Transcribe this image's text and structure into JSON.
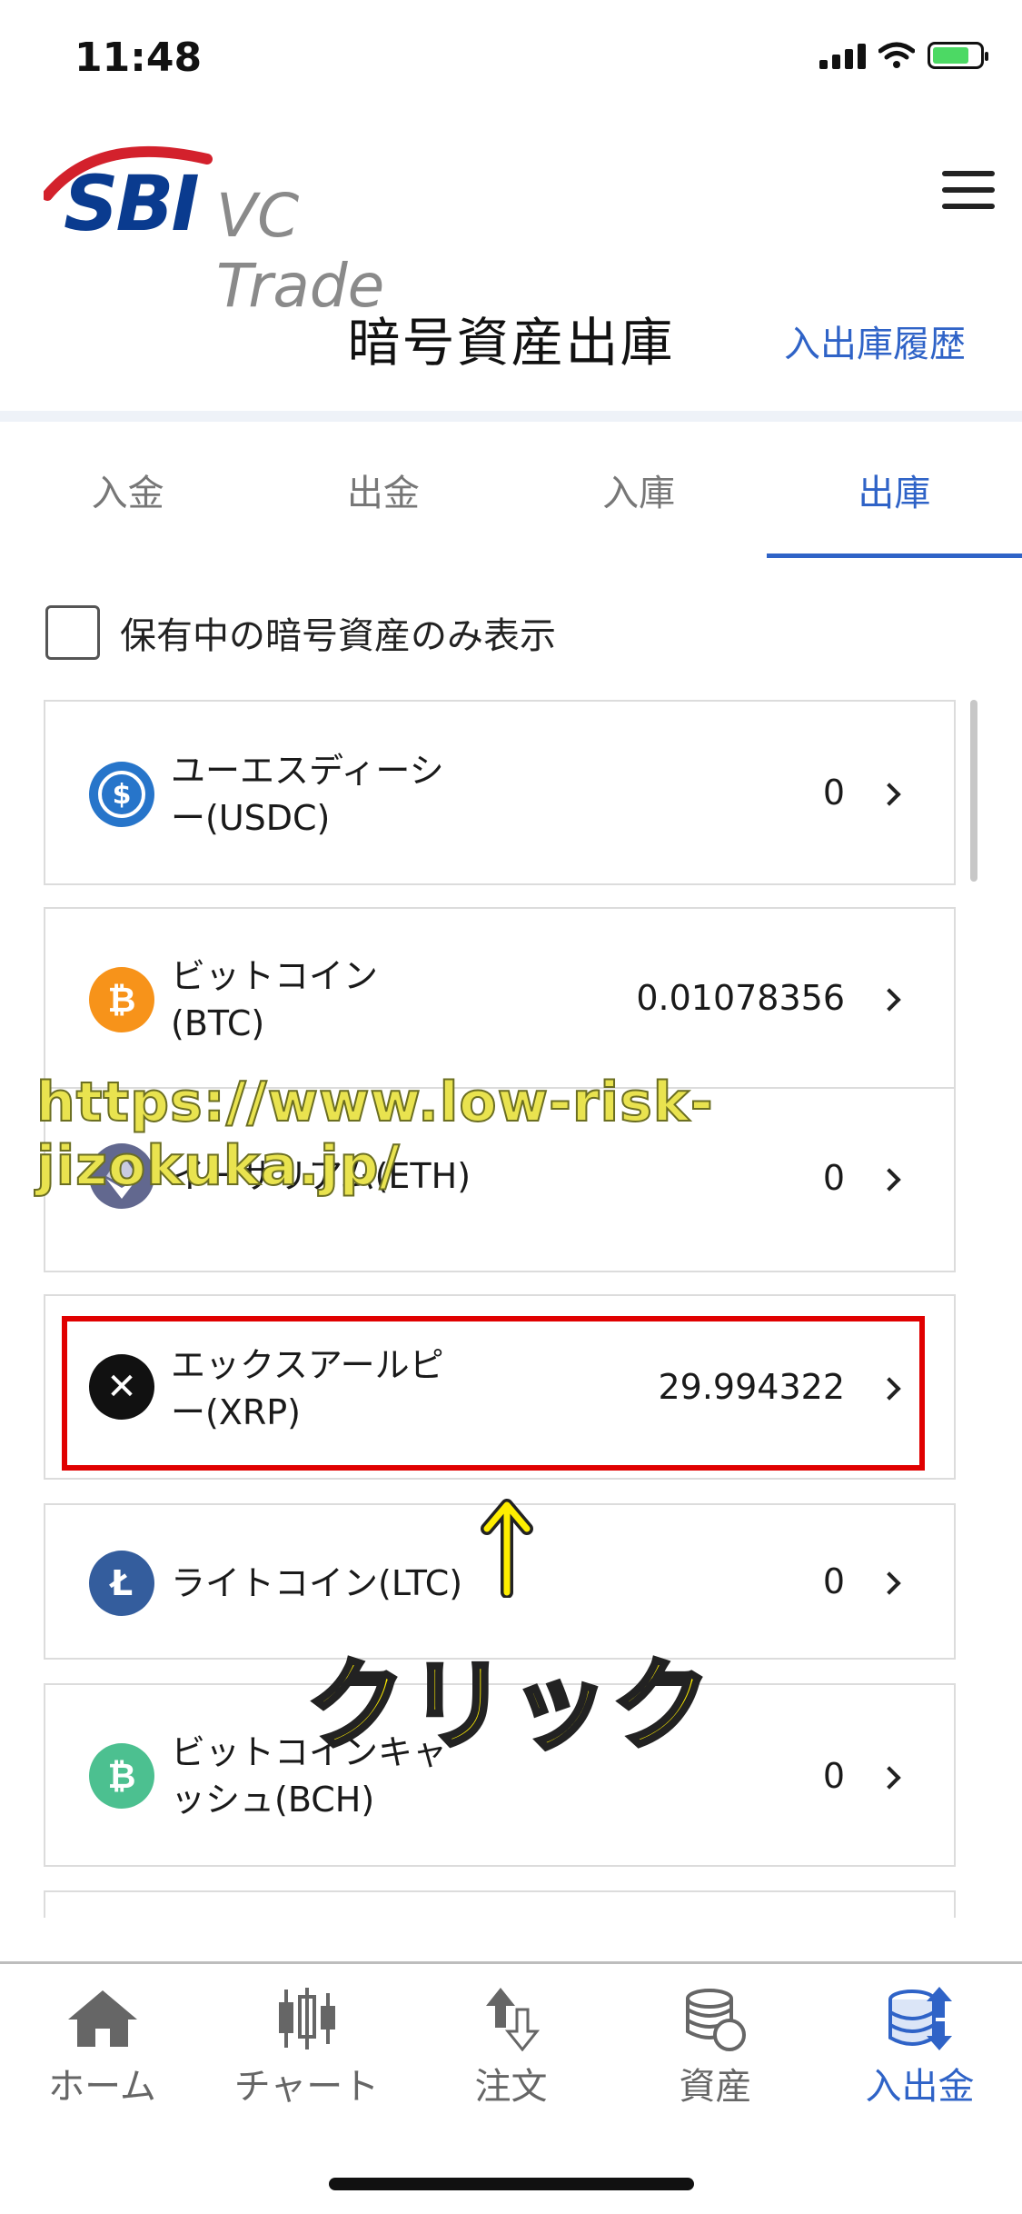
{
  "status_bar": {
    "time": "11:48"
  },
  "header": {
    "logo_sbi": "SBI",
    "logo_vc": "VC Trade",
    "page_title": "暗号資産出庫",
    "history_link": "入出庫履歴"
  },
  "tabs": [
    {
      "label": "入金",
      "active": false
    },
    {
      "label": "出金",
      "active": false
    },
    {
      "label": "入庫",
      "active": false
    },
    {
      "label": "出庫",
      "active": true
    }
  ],
  "filter": {
    "label": "保有中の暗号資産のみ表示",
    "checked": false
  },
  "coins": [
    {
      "name_line1": "ユーエスディーシ",
      "name_line2": "ー(USDC)",
      "amount": "0",
      "color": "#2775ca",
      "glyph": "$"
    },
    {
      "name_line1": "ビットコイン",
      "name_line2": "(BTC)",
      "amount": "0.01078356",
      "color": "#f7931a",
      "glyph": "₿"
    },
    {
      "name_line1": "イーサリアム(ETH)",
      "name_line2": "",
      "amount": "0",
      "color": "#62688f",
      "glyph": "◆"
    },
    {
      "name_line1": "エックスアールピ",
      "name_line2": "ー(XRP)",
      "amount": "29.994322",
      "color": "#111111",
      "glyph": "✕"
    },
    {
      "name_line1": "ライトコイン(LTC)",
      "name_line2": "",
      "amount": "0",
      "color": "#345d9d",
      "glyph": "Ł"
    },
    {
      "name_line1": "ビットコインキャ",
      "name_line2": "ッシュ(BCH)",
      "amount": "0",
      "color": "#4cc090",
      "glyph": "₿"
    }
  ],
  "overlay": {
    "watermark": "https://www.low-risk-jizokuka.jp/",
    "click_label": "クリック"
  },
  "bottom_nav": [
    {
      "label": "ホーム",
      "icon": "home-icon",
      "active": false
    },
    {
      "label": "チャート",
      "icon": "chart-icon",
      "active": false
    },
    {
      "label": "注文",
      "icon": "order-icon",
      "active": false
    },
    {
      "label": "資産",
      "icon": "assets-icon",
      "active": false
    },
    {
      "label": "入出金",
      "icon": "deposit-withdraw-icon",
      "active": true
    }
  ],
  "colors": {
    "accent": "#2f63c7",
    "highlight": "#e00000"
  }
}
